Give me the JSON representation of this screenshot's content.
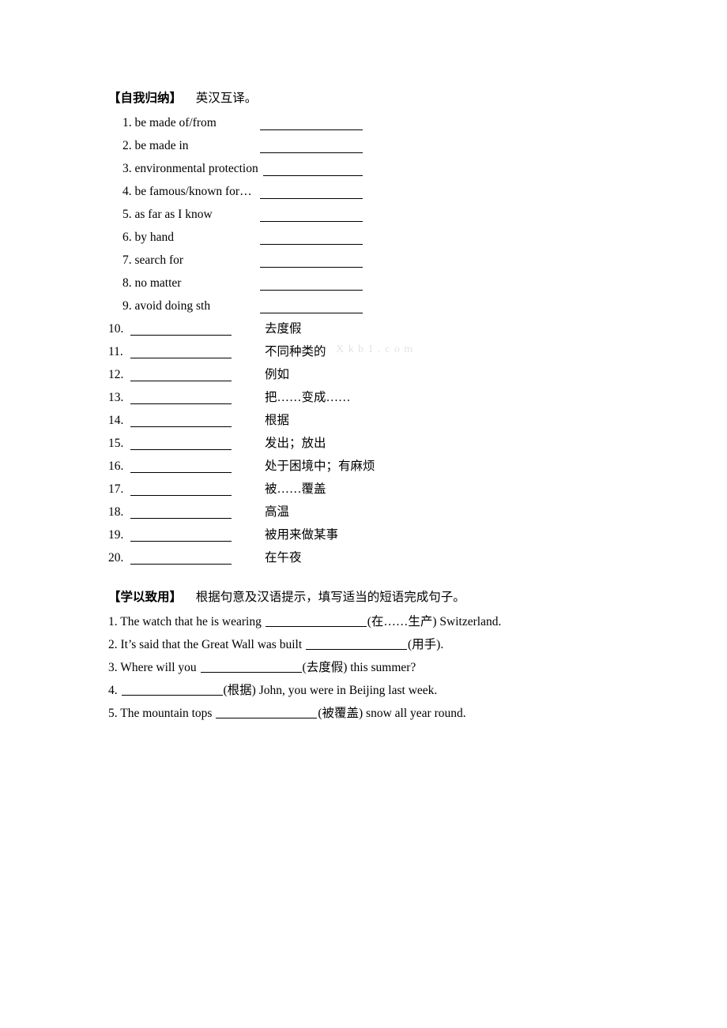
{
  "document": {
    "section_a": {
      "tag": "【自我归纳】",
      "desc": "英汉互译。",
      "items": [
        {
          "num": "1.",
          "term": "be made of/from"
        },
        {
          "num": "2.",
          "term": "be made in"
        },
        {
          "num": "3.",
          "term": "environmental protection"
        },
        {
          "num": "4.",
          "term": "be famous/known for…"
        },
        {
          "num": "5.",
          "term": "as far as I know"
        },
        {
          "num": "6.",
          "term": "by hand"
        },
        {
          "num": "7.",
          "term": "search for"
        },
        {
          "num": "8.",
          "term": "no matter"
        },
        {
          "num": "9.",
          "term": "avoid doing sth"
        }
      ],
      "cn_items": [
        {
          "num": "10.",
          "gloss": "去度假"
        },
        {
          "num": "11.",
          "gloss": "不同种类的"
        },
        {
          "num": "12.",
          "gloss": "例如"
        },
        {
          "num": "13.",
          "gloss": "把……变成……"
        },
        {
          "num": "14.",
          "gloss": "根据"
        },
        {
          "num": "15.",
          "gloss": "发出；放出"
        },
        {
          "num": "16.",
          "gloss": "处于困境中；有麻烦"
        },
        {
          "num": "17.",
          "gloss": "被……覆盖"
        },
        {
          "num": "18.",
          "gloss": "高温"
        },
        {
          "num": "19.",
          "gloss": "被用来做某事"
        },
        {
          "num": "20.",
          "gloss": "在午夜"
        }
      ]
    },
    "section_b": {
      "tag": "【学以致用】",
      "desc": "根据句意及汉语提示，填写适当的短语完成句子。",
      "sentences": [
        {
          "num": "1.",
          "before": "The watch that he is wearing ",
          "after": "(在……生产) Switzerland."
        },
        {
          "num": "2.",
          "before": "It’s said that the Great Wall was built ",
          "after": "(用手)."
        },
        {
          "num": "3.",
          "before": "Where will you ",
          "after": "(去度假) this summer?"
        },
        {
          "num": "4.",
          "before": "",
          "after": "(根据) John, you were in Beijing last week."
        },
        {
          "num": "5.",
          "before": "The mountain tops ",
          "after": "(被覆盖) snow all year round."
        }
      ]
    },
    "watermark": {
      "text": "Xkb1.com",
      "color": "#e3e3e6"
    }
  }
}
